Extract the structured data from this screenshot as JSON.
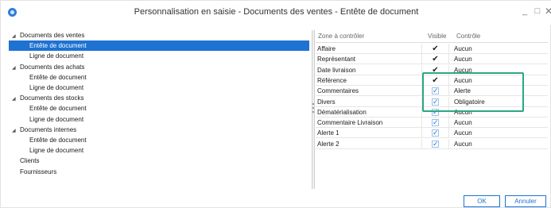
{
  "window": {
    "title": "Personnalisation en saisie - Documents des ventes - Entête de document",
    "minimize_glyph": "_",
    "maximize_glyph": "□",
    "close_glyph": "✕"
  },
  "tree": {
    "items": [
      {
        "label": "Documents des ventes",
        "level": 0,
        "expanded": true
      },
      {
        "label": "Entête de document",
        "level": 1,
        "selected": true
      },
      {
        "label": "Ligne de document",
        "level": 1
      },
      {
        "label": "Documents des achats",
        "level": 0,
        "expanded": true
      },
      {
        "label": "Entête de document",
        "level": 1
      },
      {
        "label": "Ligne de document",
        "level": 1
      },
      {
        "label": "Documents des stocks",
        "level": 0,
        "expanded": true
      },
      {
        "label": "Entête de document",
        "level": 1
      },
      {
        "label": "Ligne de document",
        "level": 1
      },
      {
        "label": "Documents internes",
        "level": 0,
        "expanded": true
      },
      {
        "label": "Entête de document",
        "level": 1
      },
      {
        "label": "Ligne de document",
        "level": 1
      },
      {
        "label": "Clients",
        "level": 0
      },
      {
        "label": "Fournisseurs",
        "level": 0
      }
    ]
  },
  "grid": {
    "columns": [
      "Zone à contrôler",
      "Visible",
      "Contrôle"
    ],
    "rows": [
      {
        "zone": "Affaire",
        "visible": "dark",
        "control": "Aucun"
      },
      {
        "zone": "Représentant",
        "visible": "dark",
        "control": "Aucun"
      },
      {
        "zone": "Date livraison",
        "visible": "dark",
        "control": "Aucun"
      },
      {
        "zone": "Référence",
        "visible": "dark",
        "control": "Aucun"
      },
      {
        "zone": "Commentaires",
        "visible": "box",
        "control": "Alerte"
      },
      {
        "zone": "Divers",
        "visible": "box",
        "control": "Obligatoire"
      },
      {
        "zone": "Dématérialisation",
        "visible": "box",
        "control": "Aucun",
        "selected": true
      },
      {
        "zone": "Commentaire Livraison",
        "visible": "box",
        "control": "Aucun"
      },
      {
        "zone": "Alerte 1",
        "visible": "box",
        "control": "Aucun"
      },
      {
        "zone": "Alerte 2",
        "visible": "box",
        "control": "Aucun"
      }
    ]
  },
  "buttons": {
    "ok": "OK",
    "cancel": "Annuler"
  },
  "colors": {
    "accent": "#1e72d2",
    "highlight_frame": "#2aa884"
  }
}
